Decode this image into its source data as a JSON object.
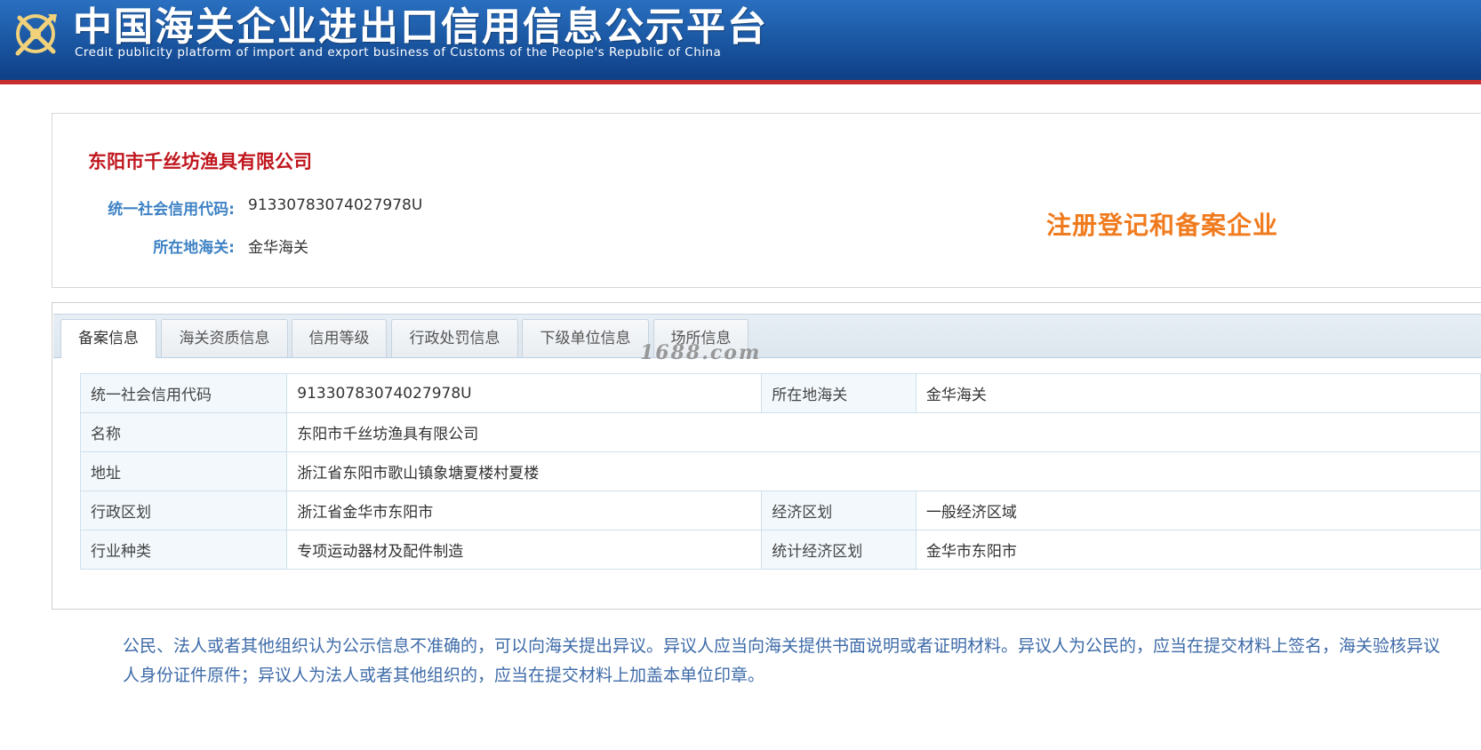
{
  "header": {
    "title": "中国海关企业进出口信用信息公示平台",
    "subtitle": "Credit publicity platform of import and export business of Customs of the People's Republic of China",
    "logo_icon": "customs-emblem-icon",
    "colors": {
      "banner": "#1c5aa6",
      "accent_line": "#c82e2e"
    }
  },
  "company": {
    "name": "东阳市千丝坊渔具有限公司",
    "credit_code_label": "统一社会信用代码:",
    "credit_code": "91330783074027978U",
    "customs_label": "所在地海关:",
    "customs": "金华海关",
    "status_stamp": "注册登记和备案企业",
    "colors": {
      "name": "#c0171f",
      "label": "#3e82c4",
      "stamp": "#f07b1e"
    }
  },
  "tabs": [
    {
      "label": "备案信息",
      "active": true
    },
    {
      "label": "海关资质信息",
      "active": false
    },
    {
      "label": "信用等级",
      "active": false
    },
    {
      "label": "行政处罚信息",
      "active": false
    },
    {
      "label": "下级单位信息",
      "active": false
    },
    {
      "label": "场所信息",
      "active": false
    }
  ],
  "watermark": "1688.com",
  "table": {
    "rows": [
      {
        "label1": "统一社会信用代码",
        "value1": "91330783074027978U",
        "label2": "所在地海关",
        "value2": "金华海关"
      },
      {
        "label1": "名称",
        "value1": "东阳市千丝坊渔具有限公司"
      },
      {
        "label1": "地址",
        "value1": "浙江省东阳市歌山镇象塘夏楼村夏楼"
      },
      {
        "label1": "行政区划",
        "value1": "浙江省金华市东阳市",
        "label2": "经济区划",
        "value2": "一般经济区域"
      },
      {
        "label1": "行业种类",
        "value1": "专项运动器材及配件制造",
        "label2": "统计经济区划",
        "value2": "金华市东阳市"
      }
    ]
  },
  "notice": "公民、法人或者其他组织认为公示信息不准确的，可以向海关提出异议。异议人应当向海关提供书面说明或者证明材料。异议人为公民的，应当在提交材料上签名，海关验核异议人身份证件原件；异议人为法人或者其他组织的，应当在提交材料上加盖本单位印章。"
}
